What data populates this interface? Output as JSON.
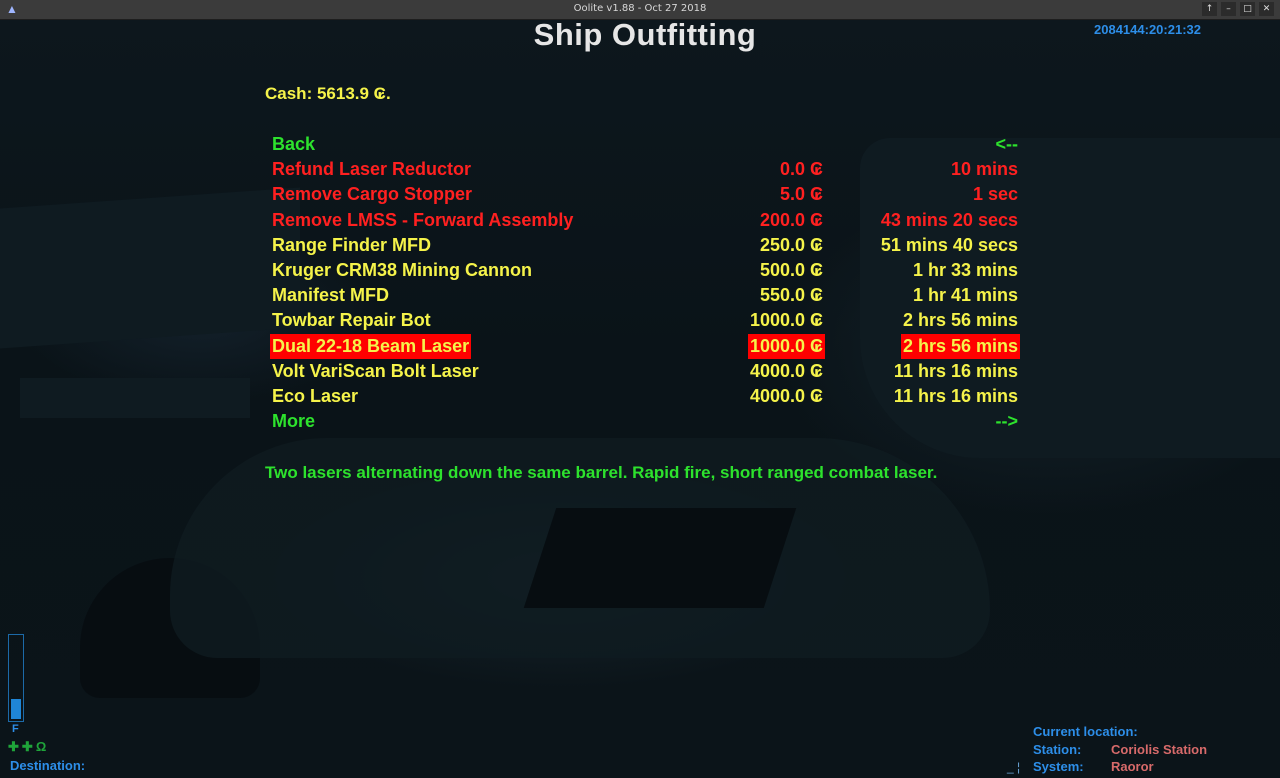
{
  "window": {
    "title": "Oolite v1.88 - Oct 27 2018",
    "buttons": [
      "↑",
      "–",
      "□",
      "✕"
    ]
  },
  "screen": {
    "title": "Ship Outfitting",
    "clock": "2084144:20:21:32"
  },
  "cash": "Cash: 5613.9 ₢.",
  "menu": [
    {
      "name": "Back",
      "price": "",
      "time": "<--",
      "color": "green",
      "selected": false
    },
    {
      "name": "Refund Laser Reductor",
      "price": "0.0 ₢",
      "time": "10 mins",
      "color": "red",
      "selected": false
    },
    {
      "name": "Remove Cargo Stopper",
      "price": "5.0 ₢",
      "time": "1 sec",
      "color": "red",
      "selected": false
    },
    {
      "name": "Remove LMSS - Forward Assembly",
      "price": "200.0 ₢",
      "time": "43 mins 20 secs",
      "color": "red",
      "selected": false
    },
    {
      "name": "Range Finder MFD",
      "price": "250.0 ₢",
      "time": "51 mins 40 secs",
      "color": "yellow",
      "selected": false
    },
    {
      "name": "Kruger CRM38 Mining Cannon",
      "price": "500.0 ₢",
      "time": "1 hr 33 mins",
      "color": "yellow",
      "selected": false
    },
    {
      "name": "Manifest MFD",
      "price": "550.0 ₢",
      "time": "1 hr 41 mins",
      "color": "yellow",
      "selected": false
    },
    {
      "name": "Towbar Repair Bot",
      "price": "1000.0 ₢",
      "time": "2 hrs 56 mins",
      "color": "yellow",
      "selected": false
    },
    {
      "name": "Dual 22-18 Beam Laser",
      "price": "1000.0 ₢",
      "time": "2 hrs 56 mins",
      "color": "yellow",
      "selected": true
    },
    {
      "name": "Volt VariScan Bolt Laser",
      "price": "4000.0 ₢",
      "time": "11 hrs 16 mins",
      "color": "yellow",
      "selected": false
    },
    {
      "name": "Eco Laser",
      "price": "4000.0 ₢",
      "time": "11 hrs 16 mins",
      "color": "yellow",
      "selected": false
    },
    {
      "name": "More",
      "price": "",
      "time": "-->",
      "color": "green",
      "selected": false
    }
  ],
  "description": "Two lasers alternating down the same barrel. Rapid fire, short ranged combat laser.",
  "hud": {
    "fuel_label": "F",
    "fuel_level": 0.25,
    "status_icons": [
      "✚",
      "✚",
      "Ω"
    ],
    "destination_label": "Destination:"
  },
  "location": {
    "header": "Current location:",
    "station_label": "Station:",
    "station_value": "Coriolis Station",
    "system_label": "System:",
    "system_value": "Raoror"
  },
  "colors": {
    "green": "#2de22d",
    "red": "#ff2020",
    "yellow": "#f5f34a",
    "highlight": "#ff0000",
    "hud_blue": "#2d8ee8"
  }
}
